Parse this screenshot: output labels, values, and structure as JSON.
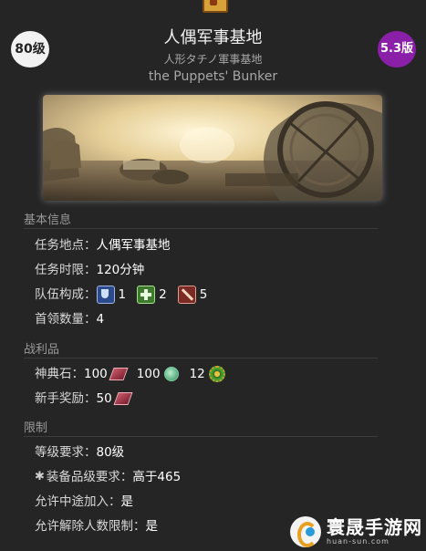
{
  "header": {
    "level_badge": "80级",
    "version_badge": "5.3版",
    "title": "人偶军事基地",
    "subtitle_jp": "人形タチノ軍事基地",
    "subtitle_en": "the Puppets' Bunker"
  },
  "basic_info": {
    "section_title": "基本信息",
    "location_label": "任务地点：",
    "location_value": "人偶军事基地",
    "time_label": "任务时限：",
    "time_value": "120分钟",
    "party_label": "队伍构成：",
    "party": [
      {
        "icon": "tank-role-icon",
        "count": "1"
      },
      {
        "icon": "healer-role-icon",
        "count": "2"
      },
      {
        "icon": "dps-role-icon",
        "count": "5"
      }
    ],
    "boss_label": "首领数量：",
    "boss_value": "4"
  },
  "loot": {
    "section_title": "战利品",
    "tome_label": "神典石：",
    "tome_values": [
      "100",
      "100",
      "12"
    ],
    "novice_label": "新手奖励：",
    "novice_value": "50"
  },
  "restrictions": {
    "section_title": "限制",
    "level_label": "等级要求：",
    "level_value": "80级",
    "ilvl_label": "装备品级要求：",
    "ilvl_value": "高于465",
    "join_label": "允许中途加入：",
    "join_value": "是",
    "kick_label": "允许解除人数限制：",
    "kick_value": "是"
  },
  "watermark": {
    "name": "寰晟手游网",
    "url": "huan-sun.com"
  },
  "colors": {
    "background": "#252525",
    "version_badge": "#8a1fa8",
    "level_badge": "#f2f2f2"
  }
}
